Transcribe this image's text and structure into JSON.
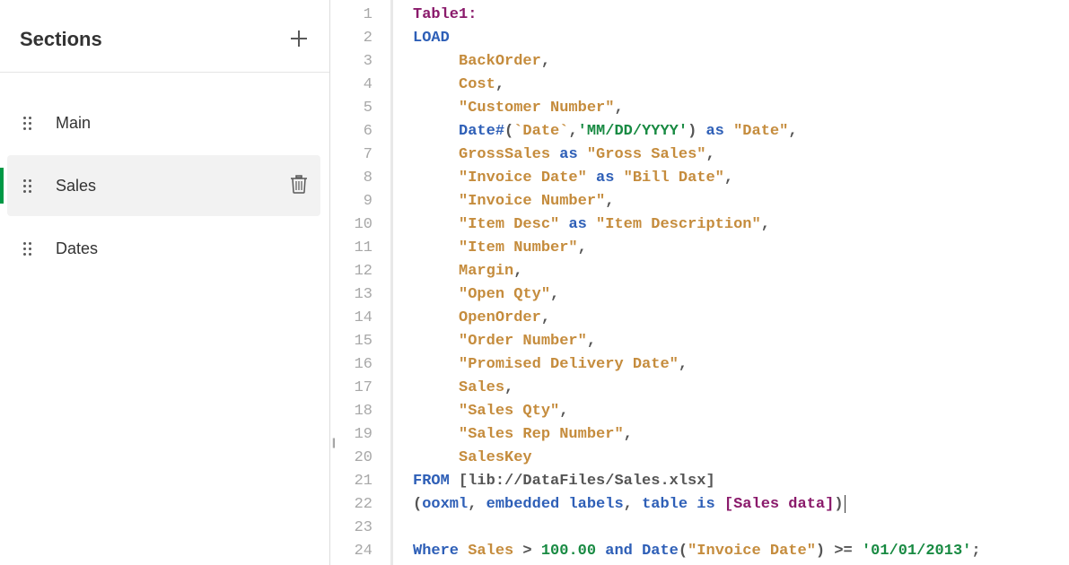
{
  "sidebar": {
    "title": "Sections",
    "items": [
      {
        "label": "Main",
        "active": false
      },
      {
        "label": "Sales",
        "active": true
      },
      {
        "label": "Dates",
        "active": false
      }
    ]
  },
  "code": {
    "lines": [
      [
        {
          "t": "Table1:",
          "c": "tok-table"
        }
      ],
      [
        {
          "t": "LOAD",
          "c": "tok-kw"
        }
      ],
      [
        {
          "t": "     ",
          "c": ""
        },
        {
          "t": "BackOrder",
          "c": "tok-field"
        },
        {
          "t": ",",
          "c": "tok-punc"
        }
      ],
      [
        {
          "t": "     ",
          "c": ""
        },
        {
          "t": "Cost",
          "c": "tok-field"
        },
        {
          "t": ",",
          "c": "tok-punc"
        }
      ],
      [
        {
          "t": "     ",
          "c": ""
        },
        {
          "t": "\"Customer Number\"",
          "c": "tok-field"
        },
        {
          "t": ",",
          "c": "tok-punc"
        }
      ],
      [
        {
          "t": "     ",
          "c": ""
        },
        {
          "t": "Date#",
          "c": "tok-kw"
        },
        {
          "t": "(",
          "c": "tok-punc"
        },
        {
          "t": "`Date`",
          "c": "tok-field"
        },
        {
          "t": ",",
          "c": "tok-punc"
        },
        {
          "t": "'MM/DD/YYYY'",
          "c": "tok-str"
        },
        {
          "t": ")",
          "c": "tok-punc"
        },
        {
          "t": " ",
          "c": ""
        },
        {
          "t": "as",
          "c": "tok-kw"
        },
        {
          "t": " ",
          "c": ""
        },
        {
          "t": "\"Date\"",
          "c": "tok-field"
        },
        {
          "t": ",",
          "c": "tok-punc"
        }
      ],
      [
        {
          "t": "     ",
          "c": ""
        },
        {
          "t": "GrossSales",
          "c": "tok-field"
        },
        {
          "t": " ",
          "c": ""
        },
        {
          "t": "as",
          "c": "tok-kw"
        },
        {
          "t": " ",
          "c": ""
        },
        {
          "t": "\"Gross Sales\"",
          "c": "tok-field"
        },
        {
          "t": ",",
          "c": "tok-punc"
        }
      ],
      [
        {
          "t": "     ",
          "c": ""
        },
        {
          "t": "\"Invoice Date\"",
          "c": "tok-field"
        },
        {
          "t": " ",
          "c": ""
        },
        {
          "t": "as",
          "c": "tok-kw"
        },
        {
          "t": " ",
          "c": ""
        },
        {
          "t": "\"Bill Date\"",
          "c": "tok-field"
        },
        {
          "t": ",",
          "c": "tok-punc"
        }
      ],
      [
        {
          "t": "     ",
          "c": ""
        },
        {
          "t": "\"Invoice Number\"",
          "c": "tok-field"
        },
        {
          "t": ",",
          "c": "tok-punc"
        }
      ],
      [
        {
          "t": "     ",
          "c": ""
        },
        {
          "t": "\"Item Desc\"",
          "c": "tok-field"
        },
        {
          "t": " ",
          "c": ""
        },
        {
          "t": "as",
          "c": "tok-kw"
        },
        {
          "t": " ",
          "c": ""
        },
        {
          "t": "\"Item Description\"",
          "c": "tok-field"
        },
        {
          "t": ",",
          "c": "tok-punc"
        }
      ],
      [
        {
          "t": "     ",
          "c": ""
        },
        {
          "t": "\"Item Number\"",
          "c": "tok-field"
        },
        {
          "t": ",",
          "c": "tok-punc"
        }
      ],
      [
        {
          "t": "     ",
          "c": ""
        },
        {
          "t": "Margin",
          "c": "tok-field"
        },
        {
          "t": ",",
          "c": "tok-punc"
        }
      ],
      [
        {
          "t": "     ",
          "c": ""
        },
        {
          "t": "\"Open Qty\"",
          "c": "tok-field"
        },
        {
          "t": ",",
          "c": "tok-punc"
        }
      ],
      [
        {
          "t": "     ",
          "c": ""
        },
        {
          "t": "OpenOrder",
          "c": "tok-field"
        },
        {
          "t": ",",
          "c": "tok-punc"
        }
      ],
      [
        {
          "t": "     ",
          "c": ""
        },
        {
          "t": "\"Order Number\"",
          "c": "tok-field"
        },
        {
          "t": ",",
          "c": "tok-punc"
        }
      ],
      [
        {
          "t": "     ",
          "c": ""
        },
        {
          "t": "\"Promised Delivery Date\"",
          "c": "tok-field"
        },
        {
          "t": ",",
          "c": "tok-punc"
        }
      ],
      [
        {
          "t": "     ",
          "c": ""
        },
        {
          "t": "Sales",
          "c": "tok-field"
        },
        {
          "t": ",",
          "c": "tok-punc"
        }
      ],
      [
        {
          "t": "     ",
          "c": ""
        },
        {
          "t": "\"Sales Qty\"",
          "c": "tok-field"
        },
        {
          "t": ",",
          "c": "tok-punc"
        }
      ],
      [
        {
          "t": "     ",
          "c": ""
        },
        {
          "t": "\"Sales Rep Number\"",
          "c": "tok-field"
        },
        {
          "t": ",",
          "c": "tok-punc"
        }
      ],
      [
        {
          "t": "     ",
          "c": ""
        },
        {
          "t": "SalesKey",
          "c": "tok-field"
        }
      ],
      [
        {
          "t": "FROM",
          "c": "tok-kw"
        },
        {
          "t": " ",
          "c": ""
        },
        {
          "t": "[lib://DataFiles/Sales.xlsx]",
          "c": "tok-bracket"
        }
      ],
      [
        {
          "t": "(",
          "c": "tok-punc"
        },
        {
          "t": "ooxml",
          "c": "tok-kw"
        },
        {
          "t": ", ",
          "c": "tok-punc"
        },
        {
          "t": "embedded labels",
          "c": "tok-kw"
        },
        {
          "t": ", ",
          "c": "tok-punc"
        },
        {
          "t": "table is",
          "c": "tok-kw"
        },
        {
          "t": " ",
          "c": ""
        },
        {
          "t": "[Sales data]",
          "c": "tok-table"
        },
        {
          "t": ")",
          "c": "tok-punc"
        },
        {
          "t": "|",
          "c": "cursor-marker"
        }
      ],
      [],
      [
        {
          "t": "Where",
          "c": "tok-kw"
        },
        {
          "t": " ",
          "c": ""
        },
        {
          "t": "Sales",
          "c": "tok-field"
        },
        {
          "t": " > ",
          "c": "tok-punc"
        },
        {
          "t": "100.00",
          "c": "tok-num"
        },
        {
          "t": " ",
          "c": ""
        },
        {
          "t": "and",
          "c": "tok-kw"
        },
        {
          "t": " ",
          "c": ""
        },
        {
          "t": "Date",
          "c": "tok-kw"
        },
        {
          "t": "(",
          "c": "tok-punc"
        },
        {
          "t": "\"Invoice Date\"",
          "c": "tok-field"
        },
        {
          "t": ")",
          "c": "tok-punc"
        },
        {
          "t": " >= ",
          "c": "tok-punc"
        },
        {
          "t": "'01/01/2013'",
          "c": "tok-str"
        },
        {
          "t": ";",
          "c": "tok-punc"
        }
      ]
    ]
  }
}
